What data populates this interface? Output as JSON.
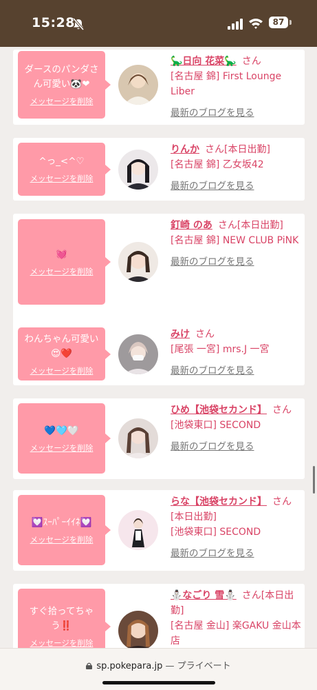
{
  "status_bar": {
    "time": "15:28",
    "battery": "87"
  },
  "delete_label": "メッセージを削除",
  "blog_label": "最新のブログを見る",
  "san": "さん",
  "items": [
    {
      "message": "ダースのパンダさん可愛い🐼❤",
      "name": "🦕日向 花菜🦕",
      "status": "",
      "shop": "[名古屋 錦] First Lounge Liber"
    },
    {
      "message": "^っ_<^♡",
      "name": "りんか",
      "status": "[本日出勤]",
      "shop": "[名古屋 錦] 乙女坂42"
    },
    {
      "message": "💓",
      "name": "釘崎 のあ",
      "status": "[本日出勤]",
      "shop": "[名古屋 錦] NEW CLUB PiNK"
    },
    {
      "message": "わんちゃん可愛い😍❤️",
      "name": "みけ",
      "status": "",
      "shop": "[尾張 一宮] mrs.J 一宮"
    },
    {
      "message": "💙🩵🤍",
      "name": "ひめ【池袋セカンド】",
      "status": "",
      "shop": "[池袋東口] SECOND"
    },
    {
      "message": "💟ｽｰﾊﾟｰｲｲﾈ💟",
      "name": "らな【池袋セカンド】",
      "status": "[本日出勤]",
      "shop": "[池袋東口] SECOND"
    },
    {
      "message": "すぐ拾ってちゃう‼️",
      "name": "⛄なごり 雪⛄",
      "status": "[本日出勤]",
      "shop": "[名古屋 金山] 楽GAKU 金山本店"
    }
  ],
  "browser": {
    "url": "sp.pokepara.jp",
    "mode": "— プライベート"
  }
}
